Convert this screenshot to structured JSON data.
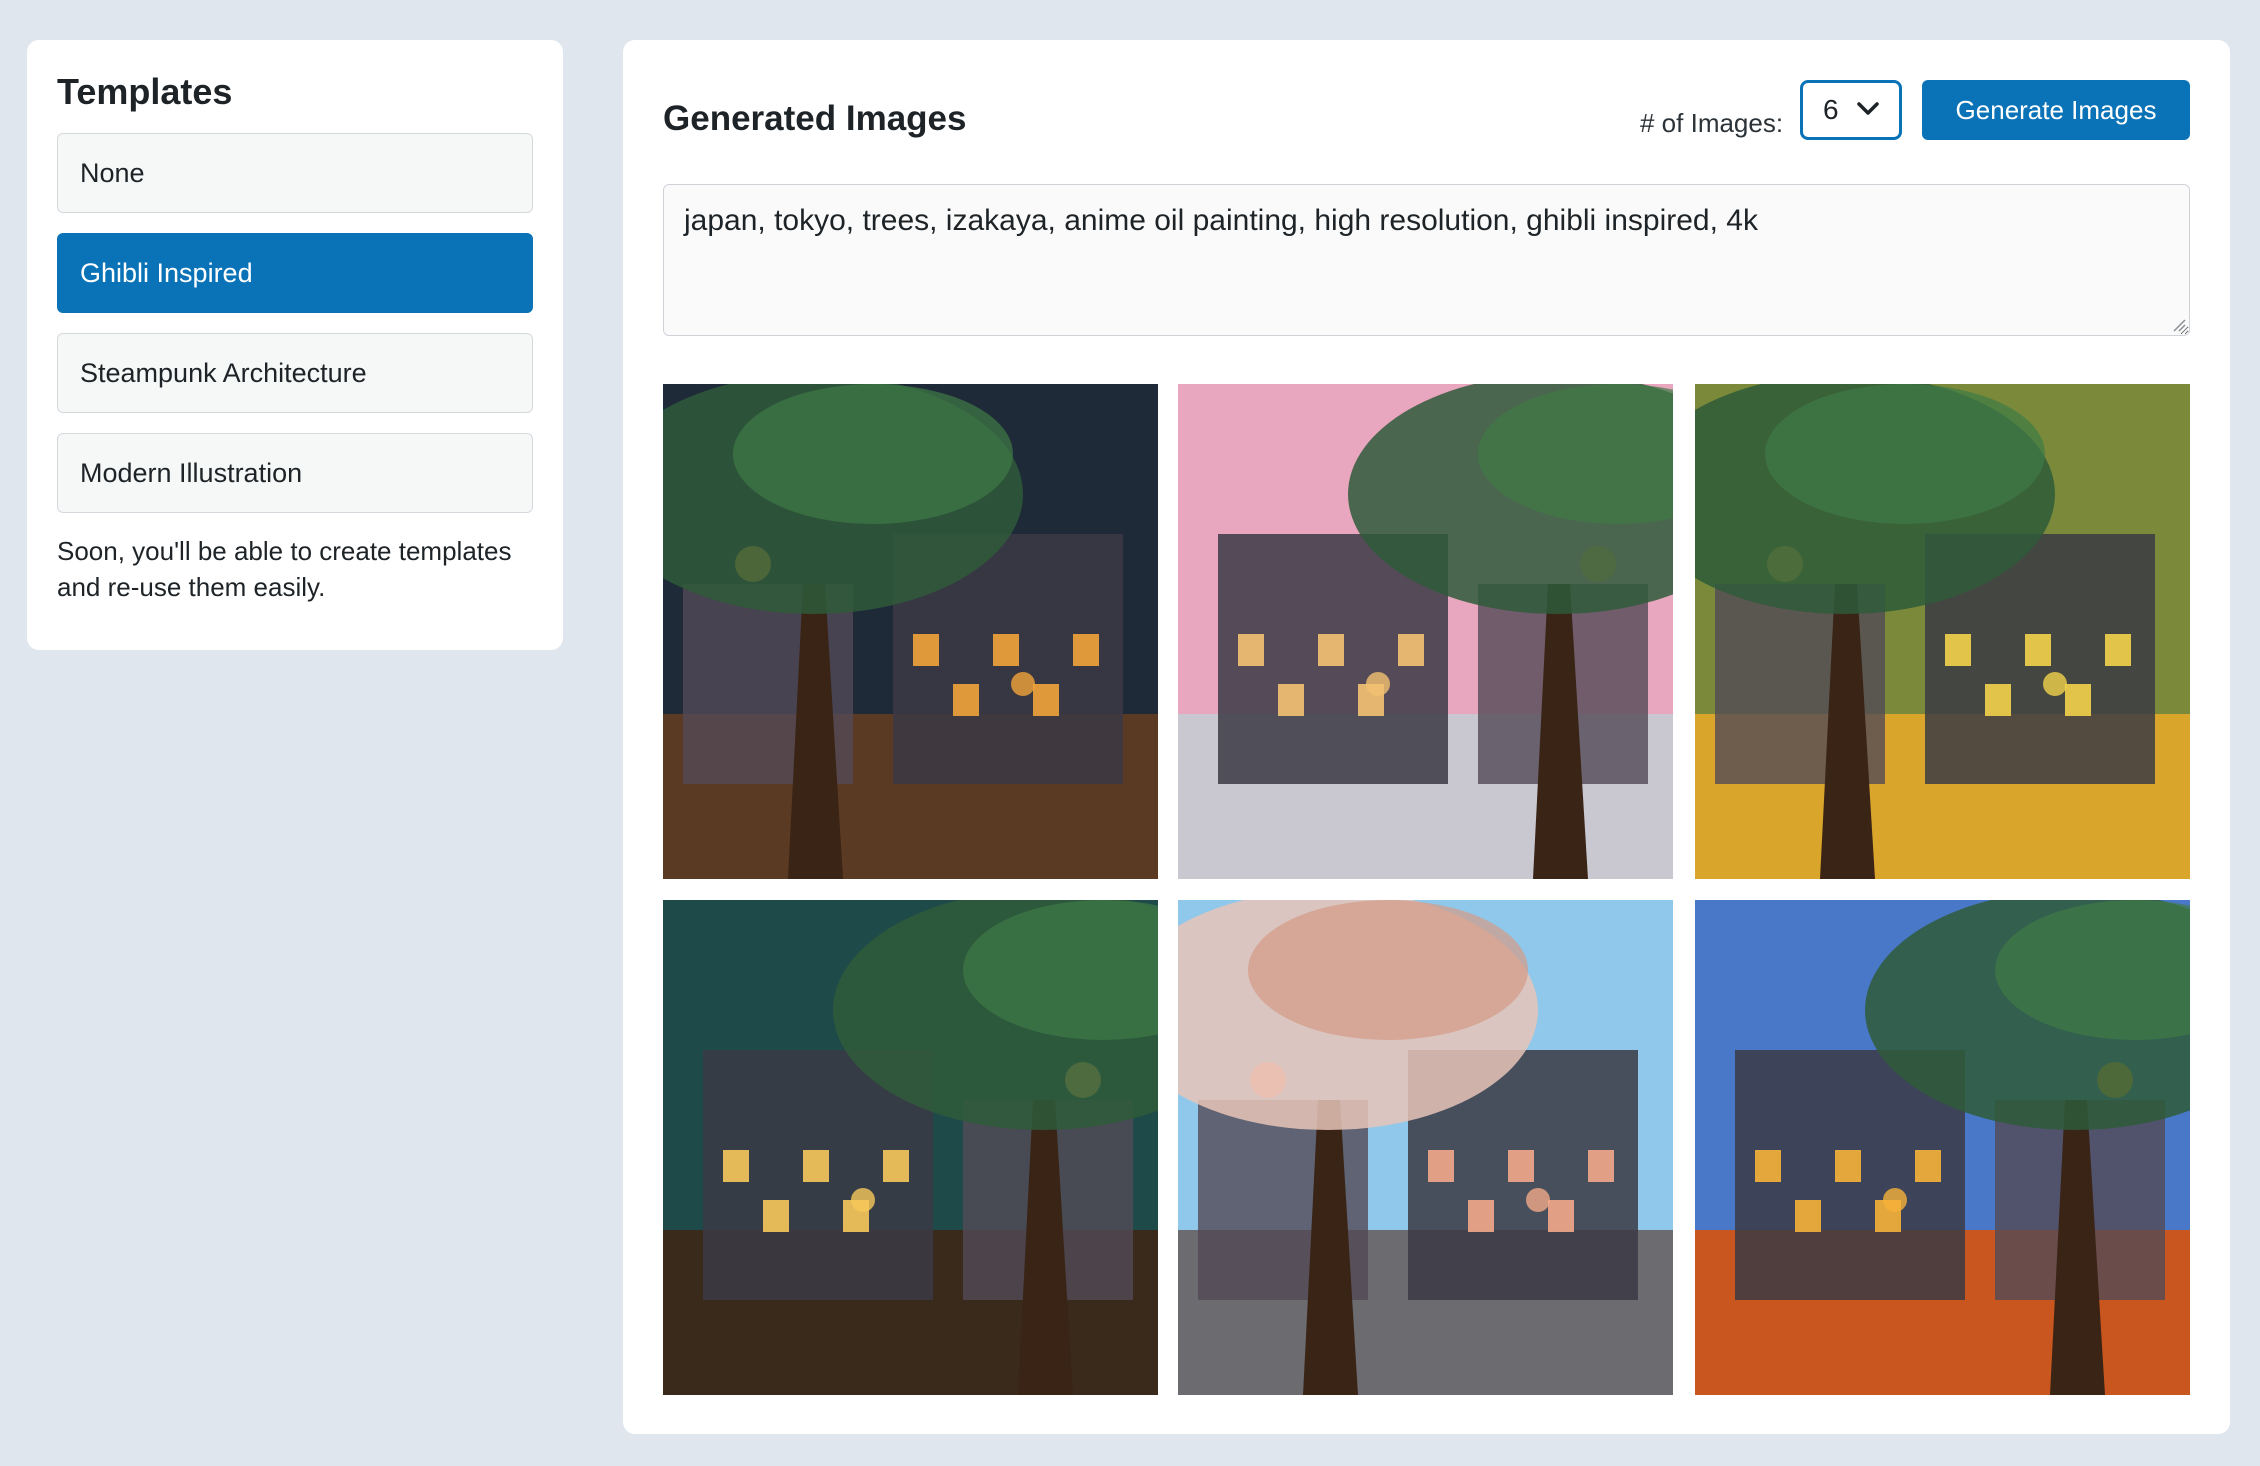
{
  "templates": {
    "title": "Templates",
    "items": [
      {
        "label": "None",
        "active": false
      },
      {
        "label": "Ghibli Inspired",
        "active": true
      },
      {
        "label": "Steampunk Architecture",
        "active": false
      },
      {
        "label": "Modern Illustration",
        "active": false
      }
    ],
    "note": "Soon, you'll be able to create templates and re-use them easily."
  },
  "generator": {
    "title": "Generated Images",
    "count_label": "# of Images:",
    "count_value": "6",
    "generate_label": "Generate Images",
    "prompt": "japan, tokyo, trees, izakaya, anime oil painting, high resolution, ghibli inspired, 4k"
  },
  "images": [
    {
      "name": "tree-izakaya-night",
      "sky": "#1e2a38",
      "ground": "#5a3a22",
      "accent": "#f2a43a"
    },
    {
      "name": "lantern-street-pink-sky",
      "sky": "#e8a6bf",
      "ground": "#c9c7cf",
      "accent": "#f4c272"
    },
    {
      "name": "ivy-building-yellow",
      "sky": "#7a8a3a",
      "ground": "#d9a52a",
      "accent": "#f3d24a"
    },
    {
      "name": "tree-cafe-evening",
      "sky": "#1f4a4a",
      "ground": "#3a2a1c",
      "accent": "#f7c85a"
    },
    {
      "name": "sakura-alley",
      "sky": "#8fc8ea",
      "ground": "#6b6b70",
      "accent": "#f2a98a"
    },
    {
      "name": "blue-street-house",
      "sky": "#4a78c8",
      "ground": "#c8561e",
      "accent": "#f6b23a"
    }
  ],
  "colors": {
    "accent": "#0a73b7",
    "background": "#e0e6ee"
  }
}
